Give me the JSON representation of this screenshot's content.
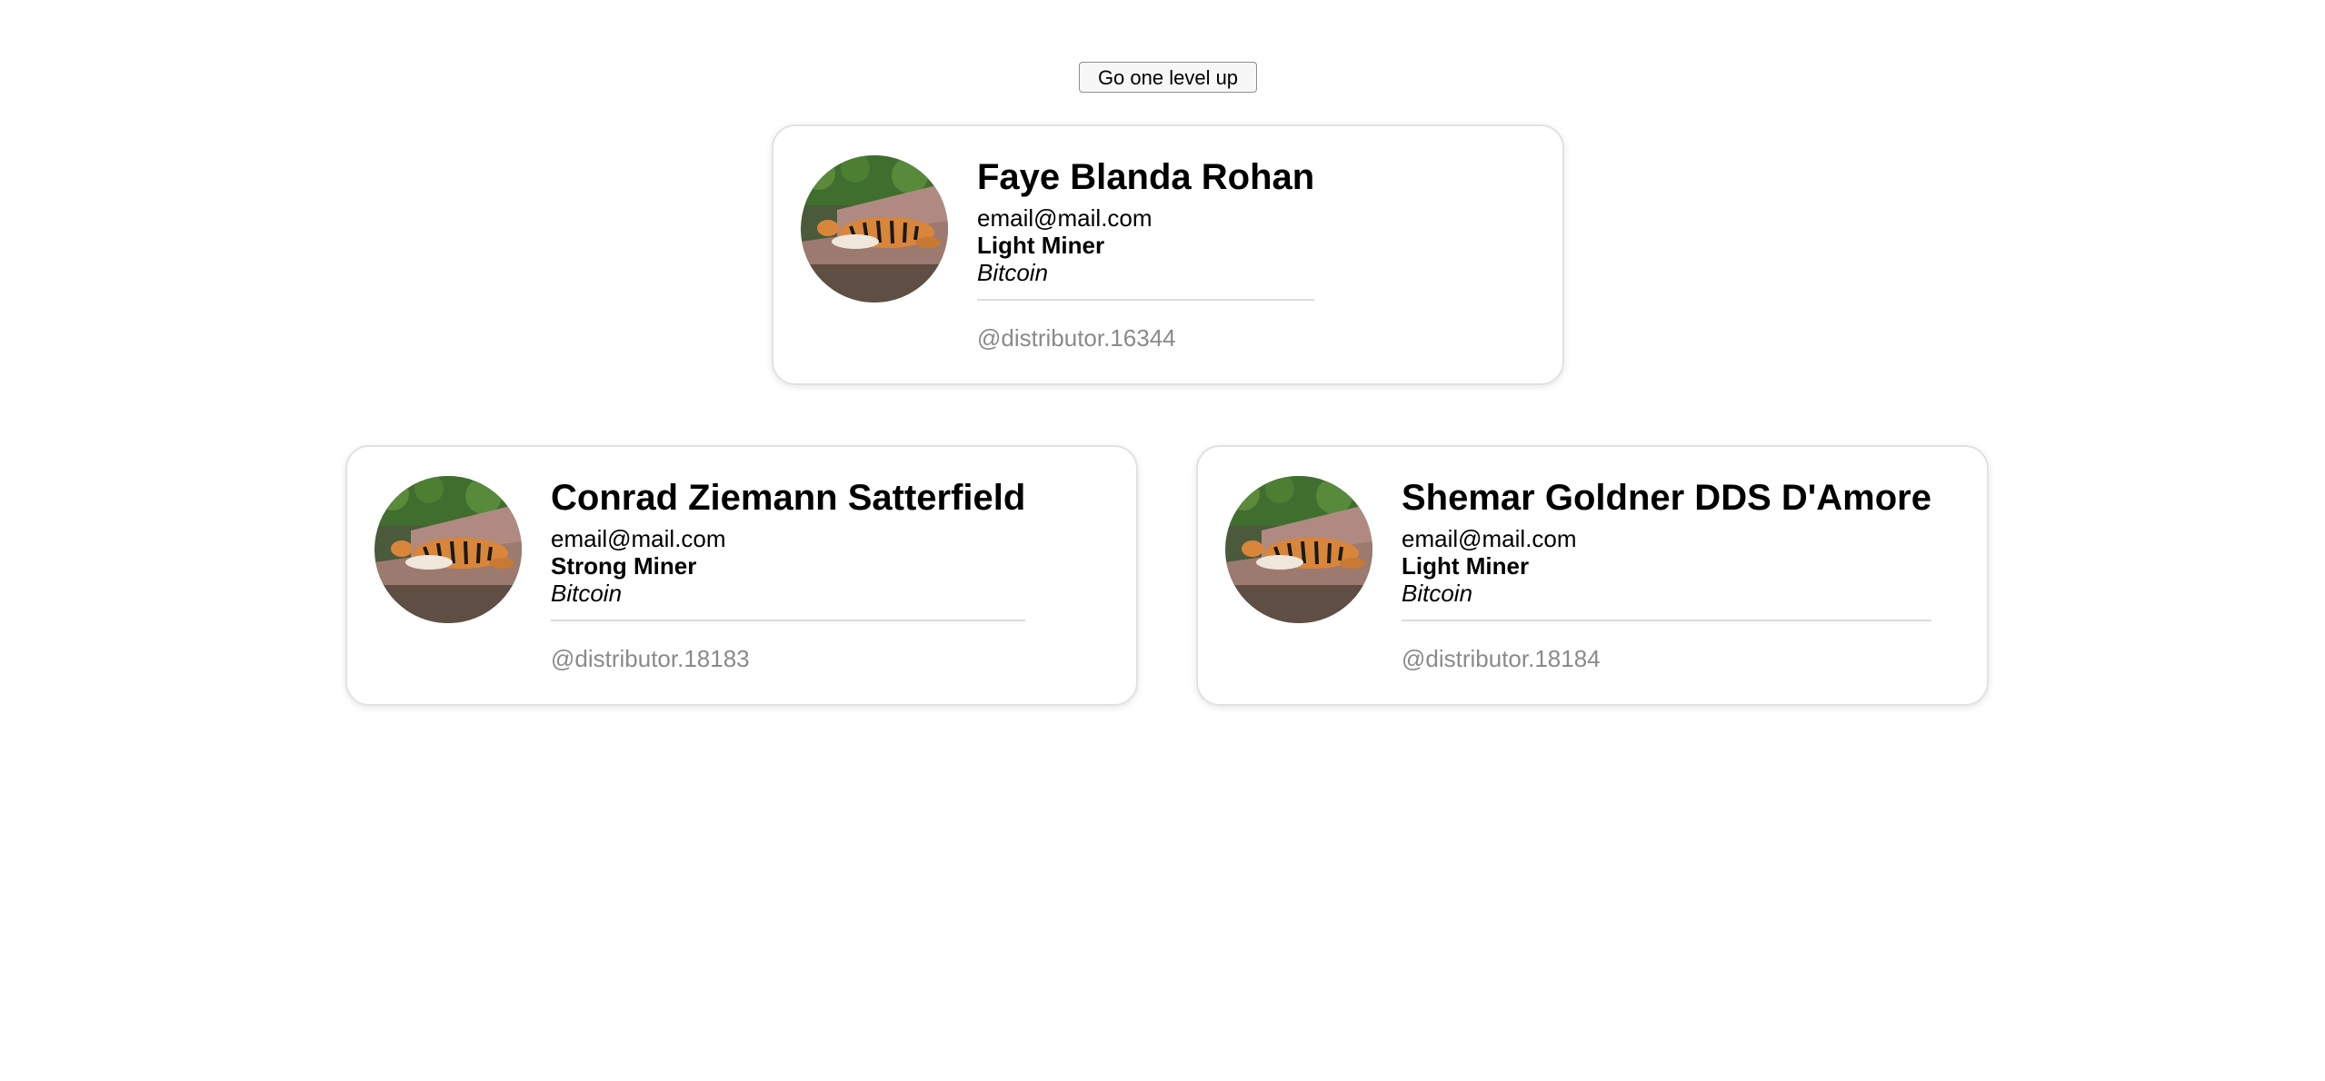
{
  "nav": {
    "up_label": "Go one level up"
  },
  "cards": [
    {
      "name": "Faye Blanda Rohan",
      "email": "email@mail.com",
      "role": "Light Miner",
      "coin": "Bitcoin",
      "handle": "@distributor.16344"
    },
    {
      "name": "Conrad Ziemann Satterfield",
      "email": "email@mail.com",
      "role": "Strong Miner",
      "coin": "Bitcoin",
      "handle": "@distributor.18183"
    },
    {
      "name": "Shemar Goldner DDS D'Amore",
      "email": "email@mail.com",
      "role": "Light Miner",
      "coin": "Bitcoin",
      "handle": "@distributor.18184"
    }
  ],
  "avatar_icon": "tiger-photo"
}
